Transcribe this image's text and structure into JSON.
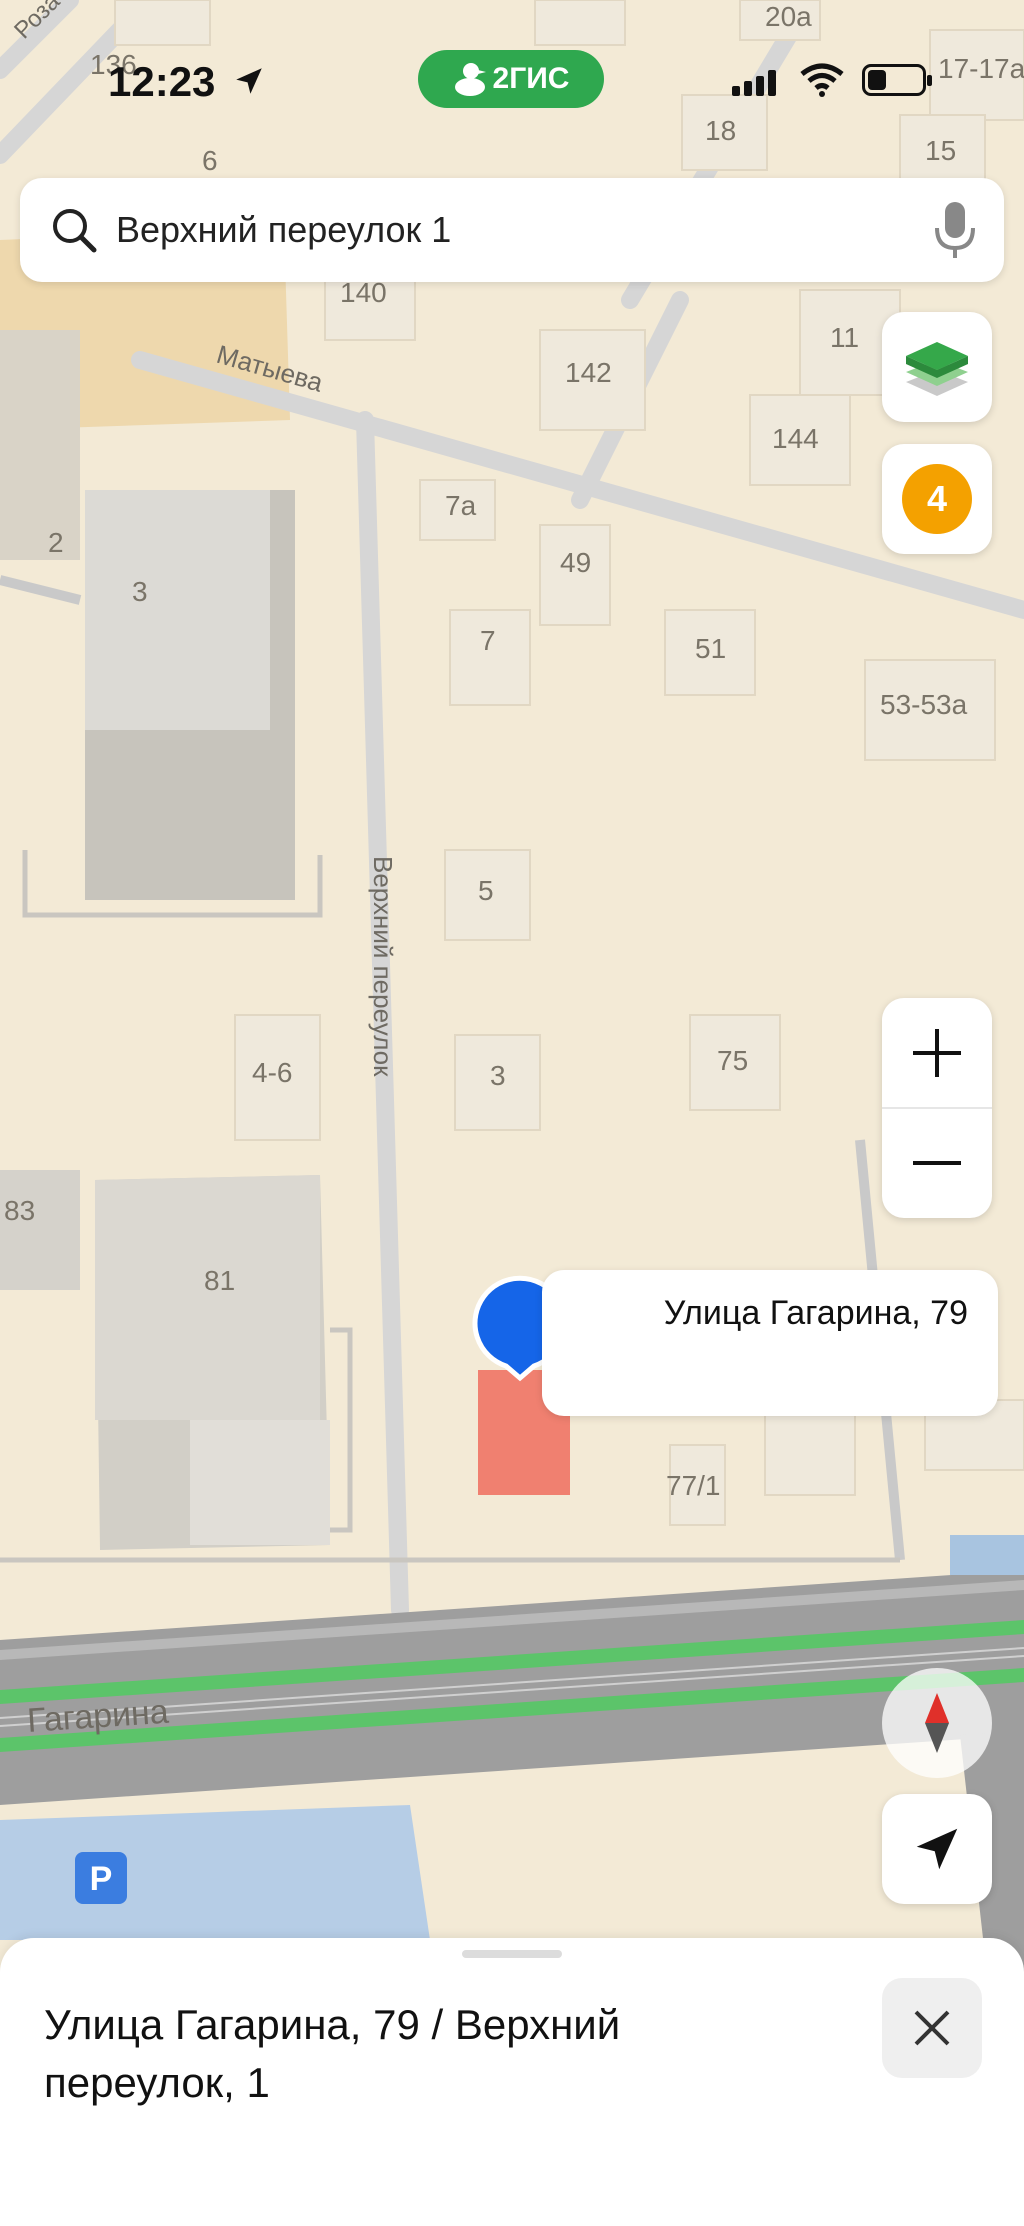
{
  "status_bar": {
    "time": "12:23",
    "brand": "2ГИС",
    "battery_level": 0.35
  },
  "search": {
    "query": "Верхний переулок 1"
  },
  "map": {
    "streets": {
      "top_left": "Роза",
      "matyeva": "Матыева",
      "verkhniy": "Верхний переулок",
      "gagarina": "Гагарина"
    },
    "buildings": [
      "136",
      "20а",
      "17-17а",
      "6",
      "18",
      "15",
      "140",
      "142",
      "11",
      "144",
      "7а",
      "2",
      "3",
      "49",
      "7",
      "51",
      "53-53а",
      "5",
      "4-6",
      "3",
      "75",
      "83",
      "81",
      "77/1"
    ],
    "parking_label": "P"
  },
  "controls": {
    "layers_icon": "layers-icon",
    "badge_count": "4",
    "zoom_in": "+",
    "zoom_out": "−",
    "compass_icon": "compass-icon",
    "my_location_icon": "navigation-arrow-icon"
  },
  "pin": {
    "label": "Улица Гагарина, 79",
    "color": "#1565e8"
  },
  "sheet": {
    "title": "Улица Гагарина, 79 / Верхний переулок, 1"
  },
  "colors": {
    "brand_green": "#2fa84f",
    "badge_orange": "#f4a100",
    "road_green": "#5cc46a",
    "selected_building": "#f08070"
  }
}
